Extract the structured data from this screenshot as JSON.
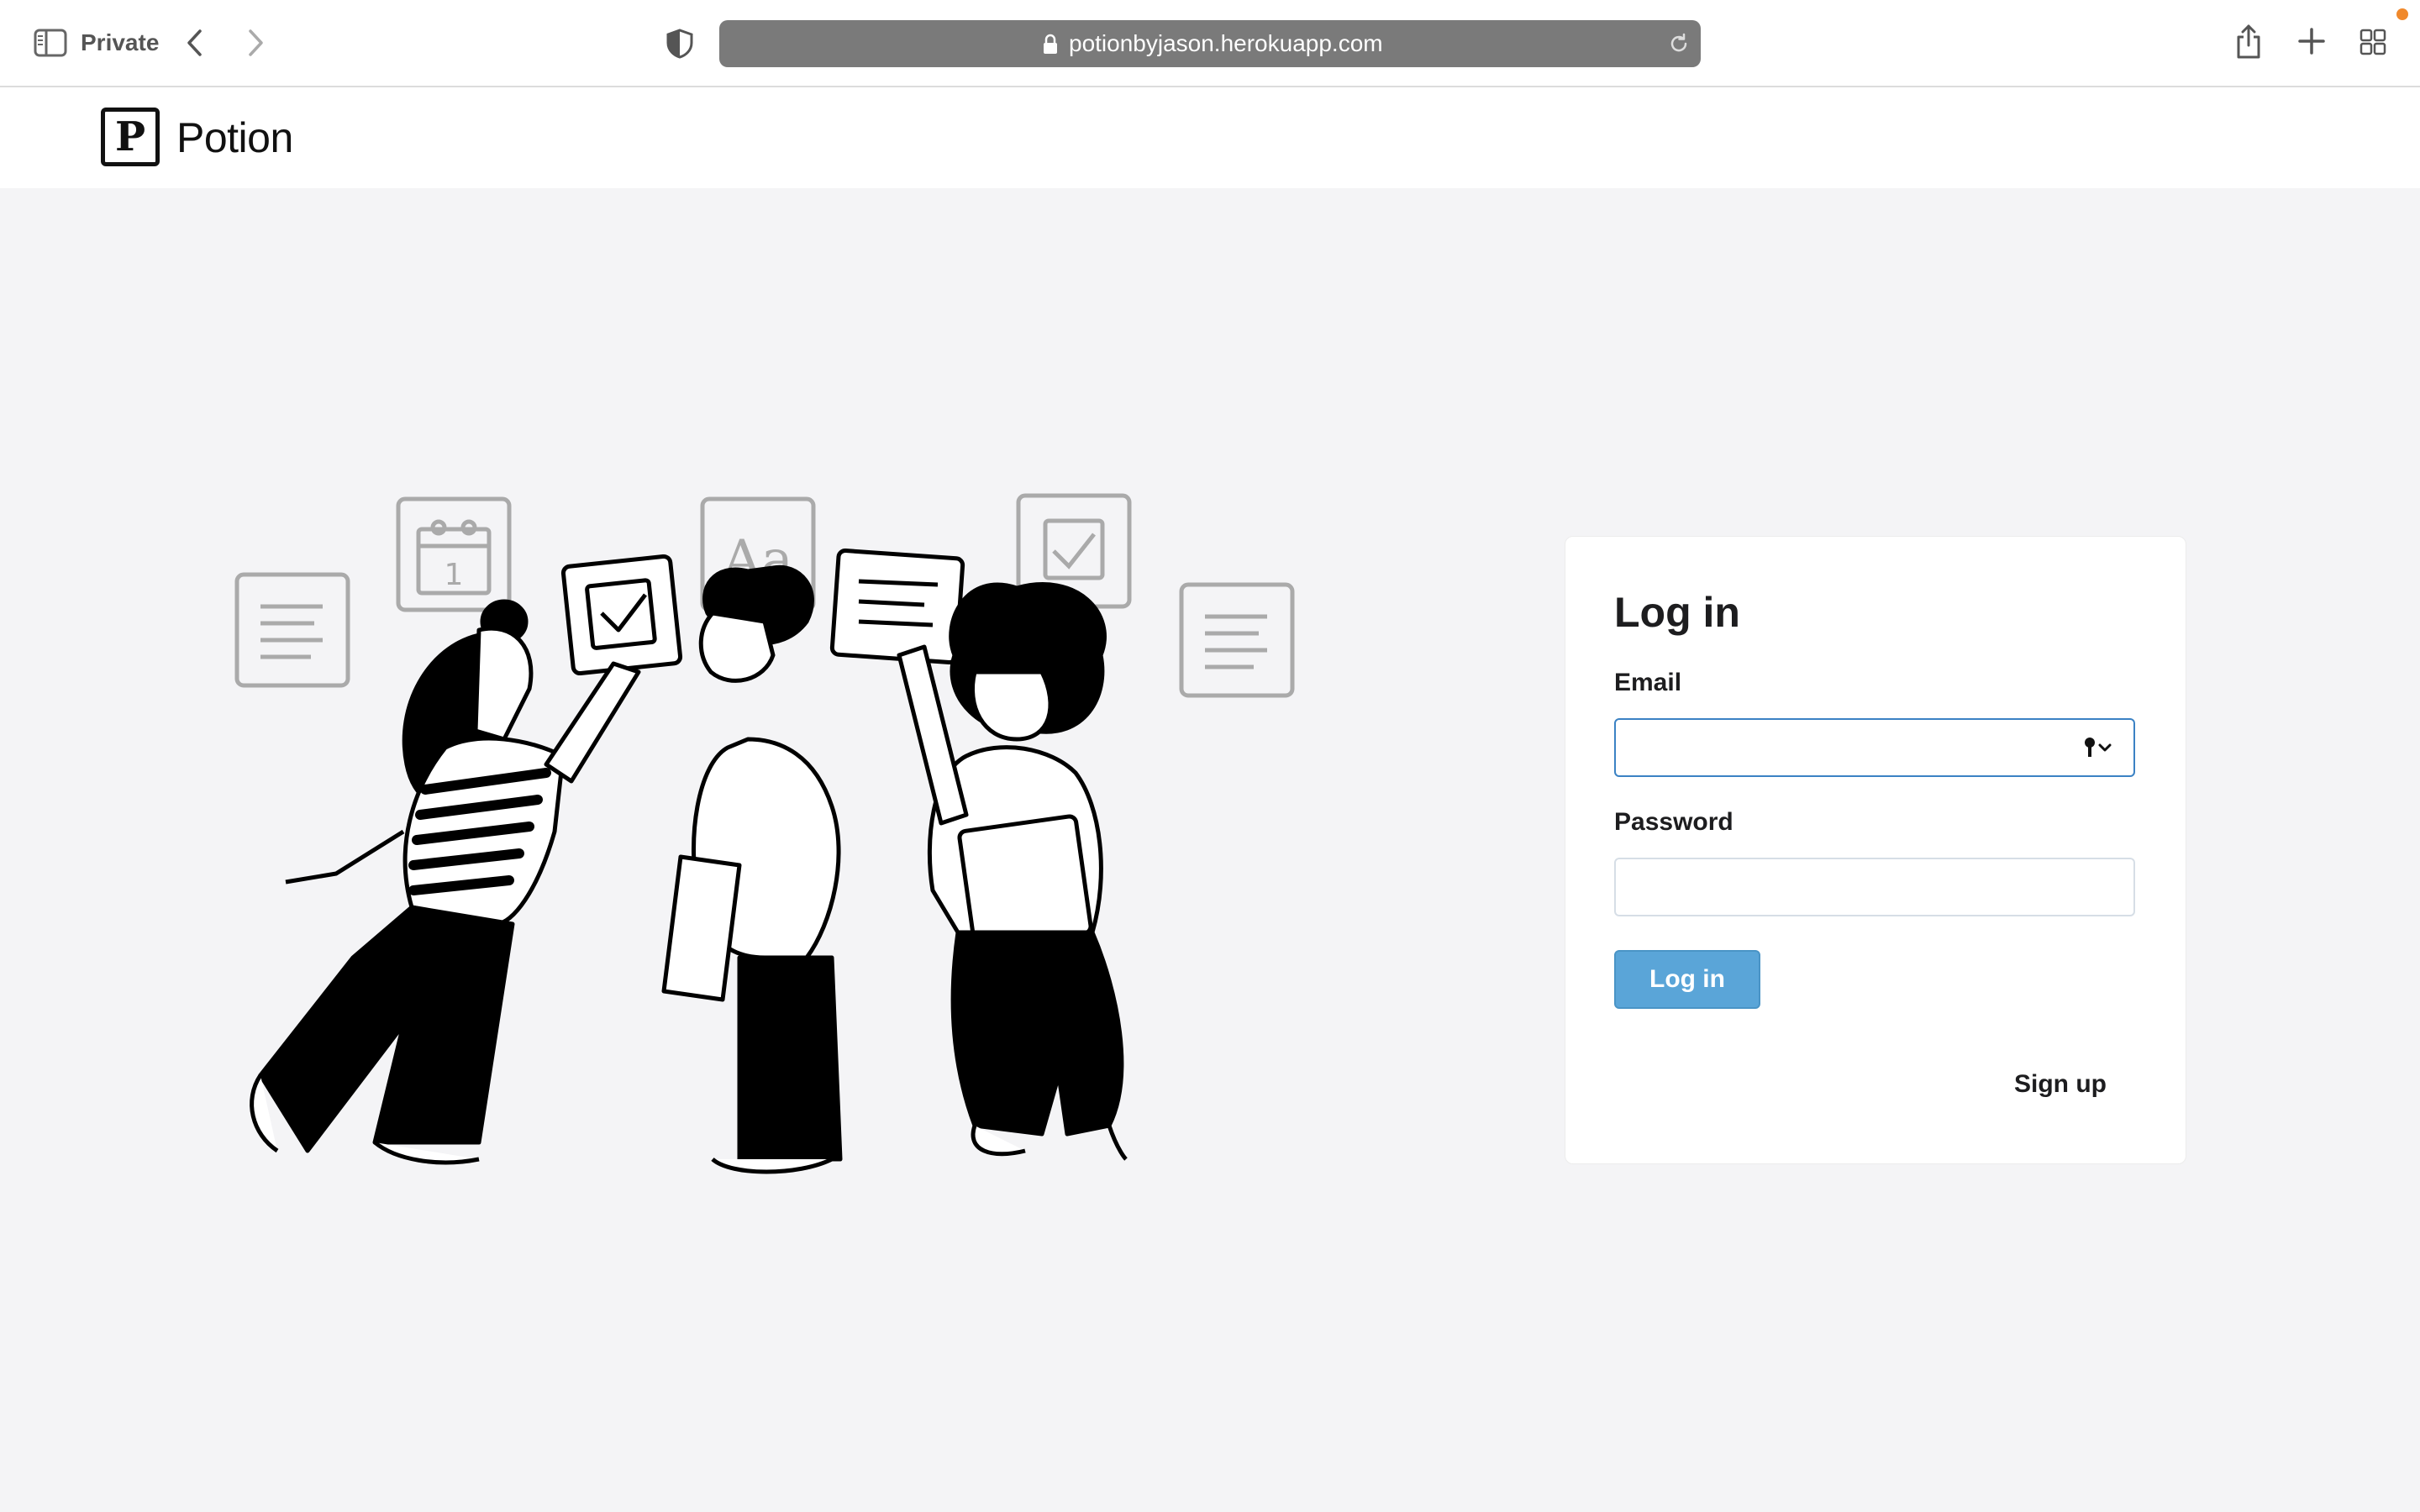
{
  "browser": {
    "mode_label": "Private",
    "url": "potionbyjason.herokuapp.com"
  },
  "app": {
    "logo_letter": "P",
    "brand_name": "Potion"
  },
  "illustration": {
    "tile_text": "Aa",
    "calendar_number": "1"
  },
  "login": {
    "title": "Log in",
    "email_label": "Email",
    "email_value": "",
    "password_label": "Password",
    "password_value": "",
    "submit_label": "Log in",
    "signup_label": "Sign up",
    "accent_color": "#5aa5d8"
  }
}
